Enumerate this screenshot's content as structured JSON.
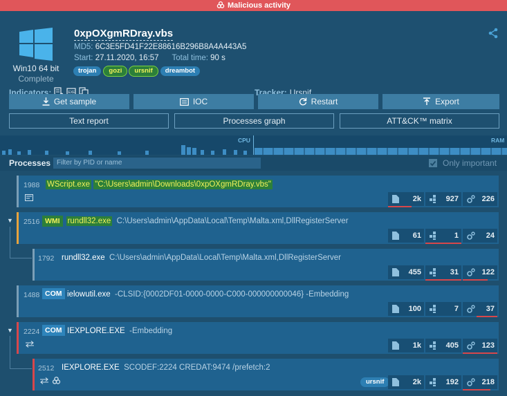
{
  "banner": {
    "label": "Malicious activity"
  },
  "os": {
    "name": "Win10 64 bit",
    "status": "Complete"
  },
  "file": {
    "name": "0xpOXgmRDray.vbs",
    "md5_label": "MD5:",
    "md5": "6C3E5FD41F22E88616B296B8A4A443A5",
    "start_label": "Start:",
    "start": "27.11.2020, 16:57",
    "total_label": "Total time:",
    "total": "90 s"
  },
  "tags": [
    "trojan",
    "gozi",
    "ursnif",
    "dreambot"
  ],
  "indicators_label": "Indicators:",
  "tracker": {
    "label": "Tracker:",
    "link": "Ursnif"
  },
  "buttons": {
    "get_sample": "Get sample",
    "ioc": "IOC",
    "restart": "Restart",
    "export": "Export"
  },
  "buttons2": {
    "text_report": "Text report",
    "processes_graph": "Processes graph",
    "attck": "ATT&CK™ matrix"
  },
  "graph": {
    "cpu": "CPU",
    "ram": "RAM"
  },
  "processes": {
    "title": "Processes",
    "filter_placeholder": "Filter by PID or name",
    "only_important": "Only important",
    "list": [
      {
        "pid": "1988",
        "name": "WScript.exe",
        "args": "\"C:\\Users\\admin\\Downloads\\0xpOXgmRDray.vbs\"",
        "stats": [
          "2k",
          "927",
          "226"
        ]
      },
      {
        "pid": "2516",
        "badge": "WMI",
        "name": "rundll32.exe",
        "args": "C:\\Users\\admin\\AppData\\Local\\Temp\\Malta.xml,DllRegisterServer",
        "stats": [
          "61",
          "1",
          "24"
        ]
      },
      {
        "pid": "1792",
        "name": "rundll32.exe",
        "args": "C:\\Users\\admin\\AppData\\Local\\Temp\\Malta.xml,DllRegisterServer",
        "stats": [
          "455",
          "31",
          "122"
        ]
      },
      {
        "pid": "1488",
        "badge": "COM",
        "name": "ielowutil.exe",
        "args": "-CLSID:{0002DF01-0000-0000-C000-000000000046} -Embedding",
        "stats": [
          "100",
          "7",
          "37"
        ]
      },
      {
        "pid": "2224",
        "badge": "COM",
        "name": "IEXPLORE.EXE",
        "args": "-Embedding",
        "stats": [
          "1k",
          "405",
          "123"
        ]
      },
      {
        "pid": "2512",
        "name": "IEXPLORE.EXE",
        "args": "SCODEF:2224 CREDAT:9474 /prefetch:2",
        "tag": "ursnif",
        "stats": [
          "2k",
          "192",
          "218"
        ]
      }
    ]
  },
  "colors": {
    "background": "#1e4f6e",
    "banner": "#e0565a",
    "accent": "#2d7fb3",
    "highlight": "#f1f15a"
  }
}
